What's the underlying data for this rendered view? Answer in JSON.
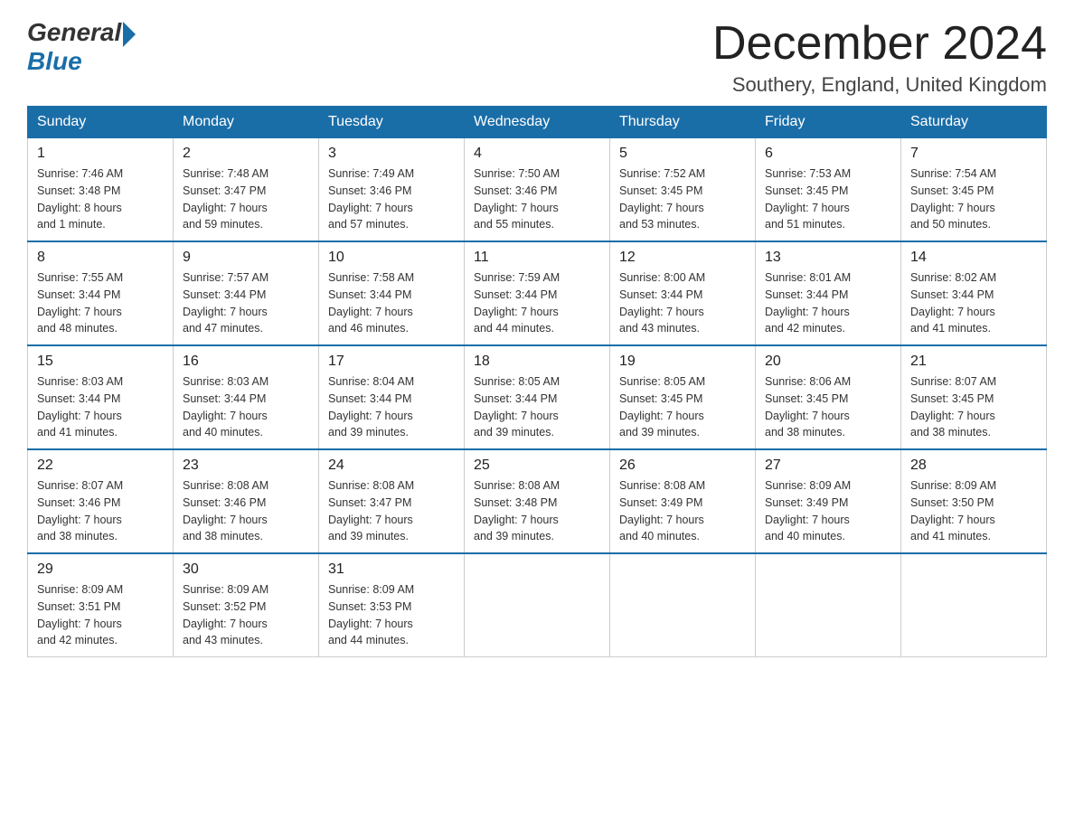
{
  "header": {
    "logo": {
      "general": "General",
      "blue": "Blue"
    },
    "title": "December 2024",
    "location": "Southery, England, United Kingdom"
  },
  "weekdays": [
    "Sunday",
    "Monday",
    "Tuesday",
    "Wednesday",
    "Thursday",
    "Friday",
    "Saturday"
  ],
  "weeks": [
    [
      {
        "day": "1",
        "sunrise": "7:46 AM",
        "sunset": "3:48 PM",
        "daylight": "8 hours and 1 minute."
      },
      {
        "day": "2",
        "sunrise": "7:48 AM",
        "sunset": "3:47 PM",
        "daylight": "7 hours and 59 minutes."
      },
      {
        "day": "3",
        "sunrise": "7:49 AM",
        "sunset": "3:46 PM",
        "daylight": "7 hours and 57 minutes."
      },
      {
        "day": "4",
        "sunrise": "7:50 AM",
        "sunset": "3:46 PM",
        "daylight": "7 hours and 55 minutes."
      },
      {
        "day": "5",
        "sunrise": "7:52 AM",
        "sunset": "3:45 PM",
        "daylight": "7 hours and 53 minutes."
      },
      {
        "day": "6",
        "sunrise": "7:53 AM",
        "sunset": "3:45 PM",
        "daylight": "7 hours and 51 minutes."
      },
      {
        "day": "7",
        "sunrise": "7:54 AM",
        "sunset": "3:45 PM",
        "daylight": "7 hours and 50 minutes."
      }
    ],
    [
      {
        "day": "8",
        "sunrise": "7:55 AM",
        "sunset": "3:44 PM",
        "daylight": "7 hours and 48 minutes."
      },
      {
        "day": "9",
        "sunrise": "7:57 AM",
        "sunset": "3:44 PM",
        "daylight": "7 hours and 47 minutes."
      },
      {
        "day": "10",
        "sunrise": "7:58 AM",
        "sunset": "3:44 PM",
        "daylight": "7 hours and 46 minutes."
      },
      {
        "day": "11",
        "sunrise": "7:59 AM",
        "sunset": "3:44 PM",
        "daylight": "7 hours and 44 minutes."
      },
      {
        "day": "12",
        "sunrise": "8:00 AM",
        "sunset": "3:44 PM",
        "daylight": "7 hours and 43 minutes."
      },
      {
        "day": "13",
        "sunrise": "8:01 AM",
        "sunset": "3:44 PM",
        "daylight": "7 hours and 42 minutes."
      },
      {
        "day": "14",
        "sunrise": "8:02 AM",
        "sunset": "3:44 PM",
        "daylight": "7 hours and 41 minutes."
      }
    ],
    [
      {
        "day": "15",
        "sunrise": "8:03 AM",
        "sunset": "3:44 PM",
        "daylight": "7 hours and 41 minutes."
      },
      {
        "day": "16",
        "sunrise": "8:03 AM",
        "sunset": "3:44 PM",
        "daylight": "7 hours and 40 minutes."
      },
      {
        "day": "17",
        "sunrise": "8:04 AM",
        "sunset": "3:44 PM",
        "daylight": "7 hours and 39 minutes."
      },
      {
        "day": "18",
        "sunrise": "8:05 AM",
        "sunset": "3:44 PM",
        "daylight": "7 hours and 39 minutes."
      },
      {
        "day": "19",
        "sunrise": "8:05 AM",
        "sunset": "3:45 PM",
        "daylight": "7 hours and 39 minutes."
      },
      {
        "day": "20",
        "sunrise": "8:06 AM",
        "sunset": "3:45 PM",
        "daylight": "7 hours and 38 minutes."
      },
      {
        "day": "21",
        "sunrise": "8:07 AM",
        "sunset": "3:45 PM",
        "daylight": "7 hours and 38 minutes."
      }
    ],
    [
      {
        "day": "22",
        "sunrise": "8:07 AM",
        "sunset": "3:46 PM",
        "daylight": "7 hours and 38 minutes."
      },
      {
        "day": "23",
        "sunrise": "8:08 AM",
        "sunset": "3:46 PM",
        "daylight": "7 hours and 38 minutes."
      },
      {
        "day": "24",
        "sunrise": "8:08 AM",
        "sunset": "3:47 PM",
        "daylight": "7 hours and 39 minutes."
      },
      {
        "day": "25",
        "sunrise": "8:08 AM",
        "sunset": "3:48 PM",
        "daylight": "7 hours and 39 minutes."
      },
      {
        "day": "26",
        "sunrise": "8:08 AM",
        "sunset": "3:49 PM",
        "daylight": "7 hours and 40 minutes."
      },
      {
        "day": "27",
        "sunrise": "8:09 AM",
        "sunset": "3:49 PM",
        "daylight": "7 hours and 40 minutes."
      },
      {
        "day": "28",
        "sunrise": "8:09 AM",
        "sunset": "3:50 PM",
        "daylight": "7 hours and 41 minutes."
      }
    ],
    [
      {
        "day": "29",
        "sunrise": "8:09 AM",
        "sunset": "3:51 PM",
        "daylight": "7 hours and 42 minutes."
      },
      {
        "day": "30",
        "sunrise": "8:09 AM",
        "sunset": "3:52 PM",
        "daylight": "7 hours and 43 minutes."
      },
      {
        "day": "31",
        "sunrise": "8:09 AM",
        "sunset": "3:53 PM",
        "daylight": "7 hours and 44 minutes."
      },
      null,
      null,
      null,
      null
    ]
  ]
}
